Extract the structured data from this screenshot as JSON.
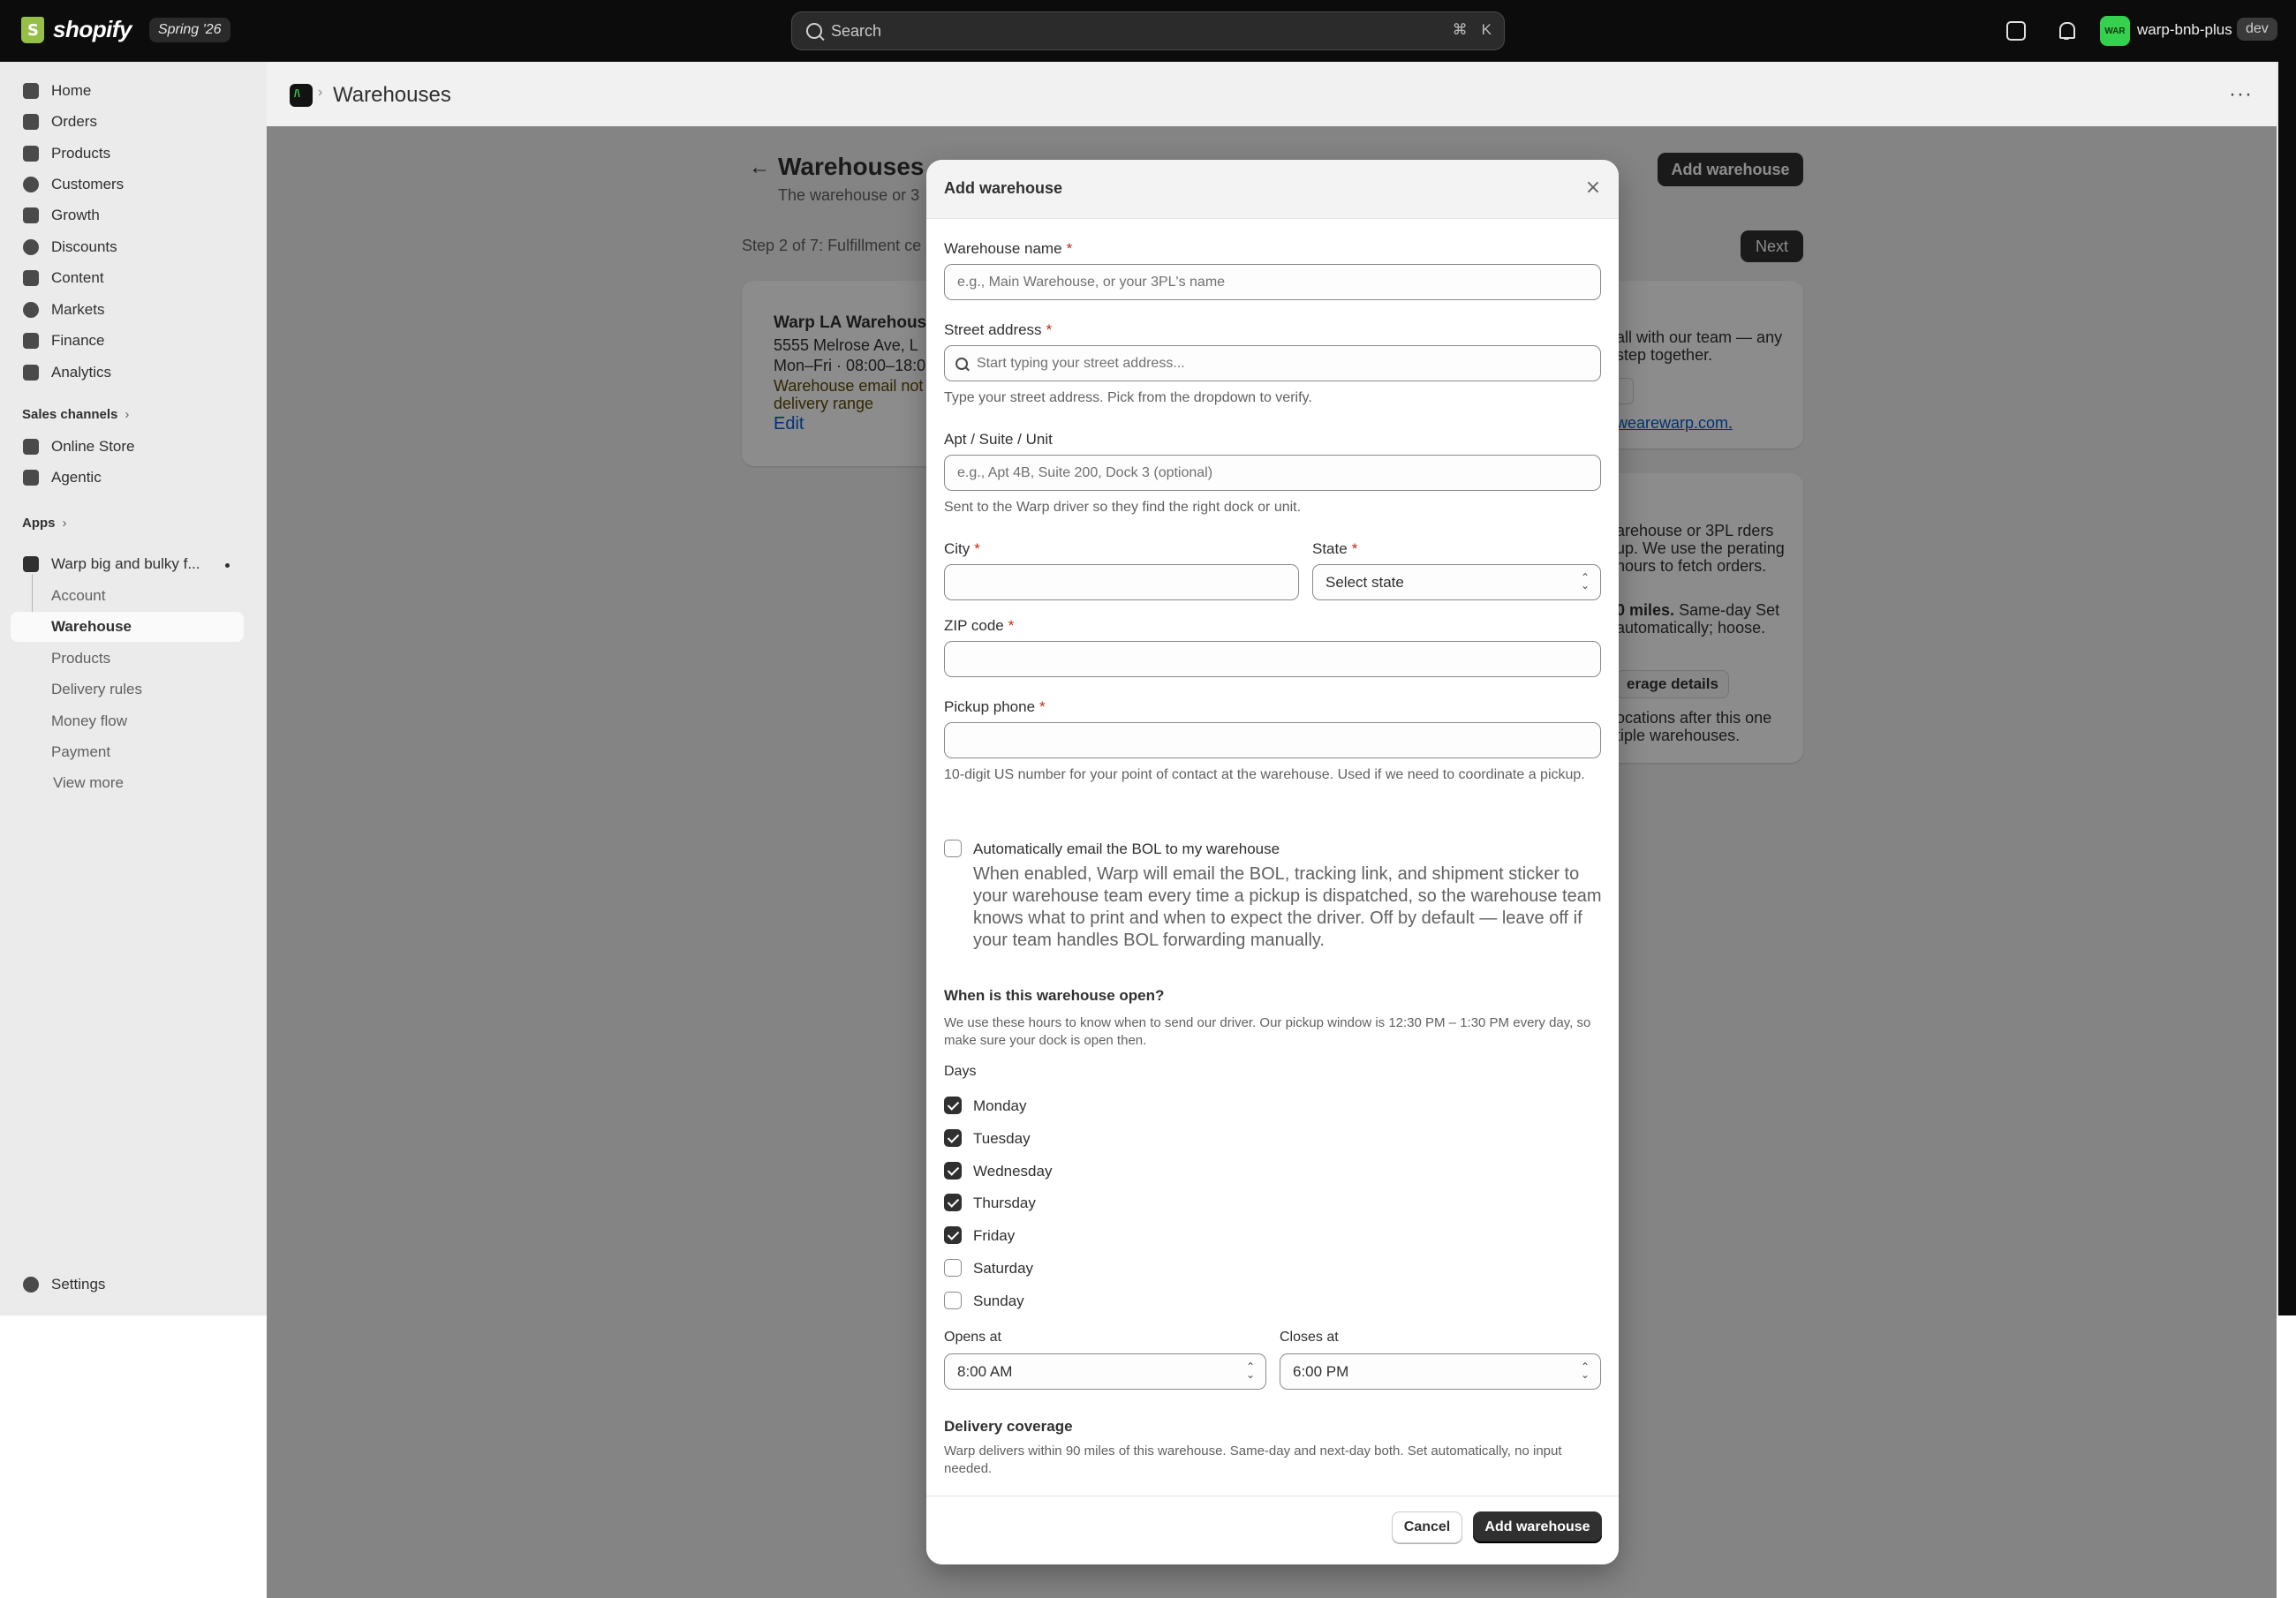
{
  "topbar": {
    "logo_text": "shopify",
    "release_badge": "Spring '26",
    "search_label": "Search",
    "search_kbd_cmd": "⌘",
    "search_kbd_key": "K",
    "avatar_initials": "WAR",
    "store_name": "warp-bnb-plus",
    "env_badge": "dev"
  },
  "sidebar": {
    "main_items": [
      {
        "label": "Home",
        "icon": "home-icon"
      },
      {
        "label": "Orders",
        "icon": "orders-icon"
      },
      {
        "label": "Products",
        "icon": "tag-icon"
      },
      {
        "label": "Customers",
        "icon": "person-icon"
      },
      {
        "label": "Growth",
        "icon": "growth-icon"
      },
      {
        "label": "Discounts",
        "icon": "discount-icon"
      },
      {
        "label": "Content",
        "icon": "content-icon"
      },
      {
        "label": "Markets",
        "icon": "globe-icon"
      },
      {
        "label": "Finance",
        "icon": "bank-icon"
      },
      {
        "label": "Analytics",
        "icon": "bar-chart-icon"
      }
    ],
    "sales_channels_label": "Sales channels",
    "channels": [
      {
        "label": "Online Store",
        "icon": "store-icon"
      },
      {
        "label": "Agentic",
        "icon": "agentic-icon"
      }
    ],
    "apps_label": "Apps",
    "app_name": "Warp big and bulky f...",
    "app_sub_items": [
      "Account",
      "Warehouse",
      "Products",
      "Delivery rules",
      "Money flow",
      "Payment",
      "View more"
    ],
    "settings_label": "Settings"
  },
  "page_header": {
    "title": "Warehouses",
    "more": "···"
  },
  "background": {
    "back_arrow": "←",
    "title": "Warehouses",
    "subtitle": "The warehouse or 3",
    "add_button": "Add warehouse",
    "step_text": "Step 2 of 7: Fulfillment ce",
    "next_button": "Next",
    "card1": {
      "name": "Warp LA Warehous",
      "address": "5555 Melrose Ave, L",
      "hours": "Mon–Fri · 08:00–18:0",
      "warning": "Warehouse email not delivery range",
      "edit": "Edit"
    },
    "card2": {
      "text": "all with our team — any step together.",
      "link": "wearewarp.com",
      "link_suffix": "."
    },
    "card3": {
      "text1": "arehouse or 3PL rders up. We use the perating hours to fetch orders.",
      "text2_bold": "0 miles.",
      "text2": "Same-day Set automatically; hoose.",
      "button": "erage details",
      "text3": "ocations after this one tiple warehouses."
    }
  },
  "modal": {
    "title": "Add warehouse",
    "close": "×",
    "warehouse_name": {
      "label": "Warehouse name",
      "required": "*",
      "placeholder": "e.g., Main Warehouse, or your 3PL's name"
    },
    "street": {
      "label": "Street address",
      "required": "*",
      "placeholder": "Start typing your street address...",
      "help": "Type your street address. Pick from the dropdown to verify."
    },
    "apt": {
      "label": "Apt / Suite / Unit",
      "placeholder": "e.g., Apt 4B, Suite 200, Dock 3 (optional)",
      "help": "Sent to the Warp driver so they find the right dock or unit."
    },
    "city": {
      "label": "City",
      "required": "*",
      "value": ""
    },
    "state": {
      "label": "State",
      "required": "*",
      "value": "Select state"
    },
    "zip": {
      "label": "ZIP code",
      "required": "*",
      "value": ""
    },
    "phone": {
      "label": "Pickup phone",
      "required": "*",
      "value": "",
      "help": "10-digit US number for your point of contact at the warehouse. Used if we need to coordinate a pickup."
    },
    "bol": {
      "label": "Automatically email the BOL to my warehouse",
      "checked": false,
      "description": "When enabled, Warp will email the BOL, tracking link, and shipment sticker to your warehouse team every time a pickup is dispatched, so the warehouse team knows what to print and when to expect the driver. Off by default — leave off if your team handles BOL forwarding manually."
    },
    "hours": {
      "title": "When is this warehouse open?",
      "description": "We use these hours to know when to send our driver. Our pickup window is 12:30 PM – 1:30 PM every day, so make sure your dock is open then.",
      "days_label": "Days",
      "days": [
        {
          "label": "Monday",
          "checked": true
        },
        {
          "label": "Tuesday",
          "checked": true
        },
        {
          "label": "Wednesday",
          "checked": true
        },
        {
          "label": "Thursday",
          "checked": true
        },
        {
          "label": "Friday",
          "checked": true
        },
        {
          "label": "Saturday",
          "checked": false
        },
        {
          "label": "Sunday",
          "checked": false
        }
      ],
      "opens_label": "Opens at",
      "opens_value": "8:00 AM",
      "closes_label": "Closes at",
      "closes_value": "6:00 PM"
    },
    "coverage": {
      "title": "Delivery coverage",
      "description": "Warp delivers within 90 miles of this warehouse. Same-day and next-day both. Set automatically, no input needed."
    },
    "cancel_button": "Cancel",
    "submit_button": "Add warehouse"
  },
  "colors": {
    "accent": "#303030",
    "brand": "#95bf47",
    "avatar": "#36d04f",
    "link": "#005bd3",
    "required": "#c5280c"
  }
}
